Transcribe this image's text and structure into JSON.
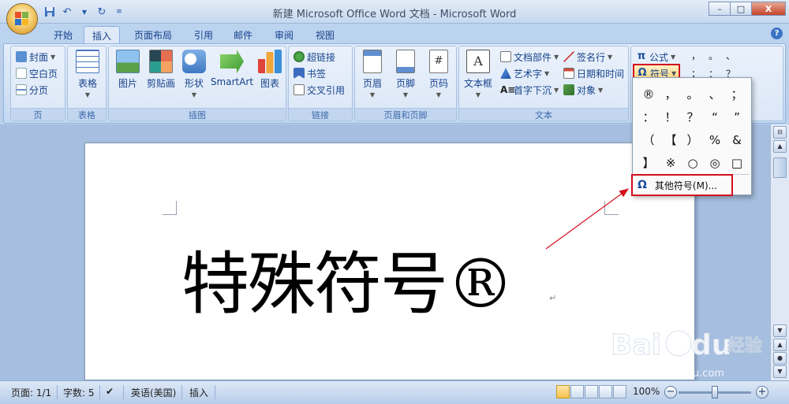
{
  "window": {
    "title": "新建 Microsoft Office Word 文档 - Microsoft Word",
    "minimize": "–",
    "maximize": "□",
    "close": "X"
  },
  "quick_access": {
    "icons": [
      "save-icon",
      "undo-icon",
      "redo-icon",
      "customize-icon"
    ]
  },
  "tabs": [
    {
      "label": "开始"
    },
    {
      "label": "插入",
      "active": true
    },
    {
      "label": "页面布局"
    },
    {
      "label": "引用"
    },
    {
      "label": "邮件"
    },
    {
      "label": "审阅"
    },
    {
      "label": "视图"
    }
  ],
  "help": "?",
  "ribbon": {
    "pages_group": {
      "label": "页",
      "cover": "封面",
      "blank_page": "空白页",
      "page_break": "分页"
    },
    "tables_group": {
      "label": "表格",
      "table": "表格"
    },
    "illustrations_group": {
      "label": "插图",
      "picture": "图片",
      "clipart": "剪贴画",
      "shapes": "形状",
      "smartart": "SmartArt",
      "chart": "图表"
    },
    "links_group": {
      "label": "链接",
      "hyperlink": "超链接",
      "bookmark": "书签",
      "cross_ref": "交叉引用"
    },
    "header_footer_group": {
      "label": "页眉和页脚",
      "header": "页眉",
      "footer": "页脚",
      "page_number": "页码"
    },
    "text_group": {
      "label": "文本",
      "textbox": "文本框",
      "quick_parts": "文档部件",
      "wordart": "艺术字",
      "drop_cap": "首字下沉",
      "signature_line": "签名行",
      "date_time": "日期和时间",
      "object": "对象"
    },
    "symbols_group": {
      "equation": "公式",
      "symbol": "符号",
      "quick_symbols": [
        "，",
        "。",
        "、",
        "；",
        "：",
        "？"
      ]
    }
  },
  "symbol_dropdown": {
    "symbols": [
      "®",
      "，",
      "。",
      "、",
      "；",
      "：",
      "！",
      "？",
      "“",
      "”",
      "（",
      "【",
      "）",
      "%",
      "&",
      "】",
      "※",
      "○",
      "◎",
      "□"
    ],
    "more_label": "其他符号(M)..."
  },
  "document": {
    "text": "特殊符号®",
    "para_mark": "↵"
  },
  "statusbar": {
    "page": "页面: 1/1",
    "words": "字数: 5",
    "language": "英语(美国)",
    "mode": "插入",
    "zoom": "100%",
    "zoom_minus": "−",
    "zoom_plus": "+"
  },
  "colors": {
    "highlight": "#d2101e",
    "ribbon_text": "#15428b",
    "arrow": "#d2101e"
  }
}
